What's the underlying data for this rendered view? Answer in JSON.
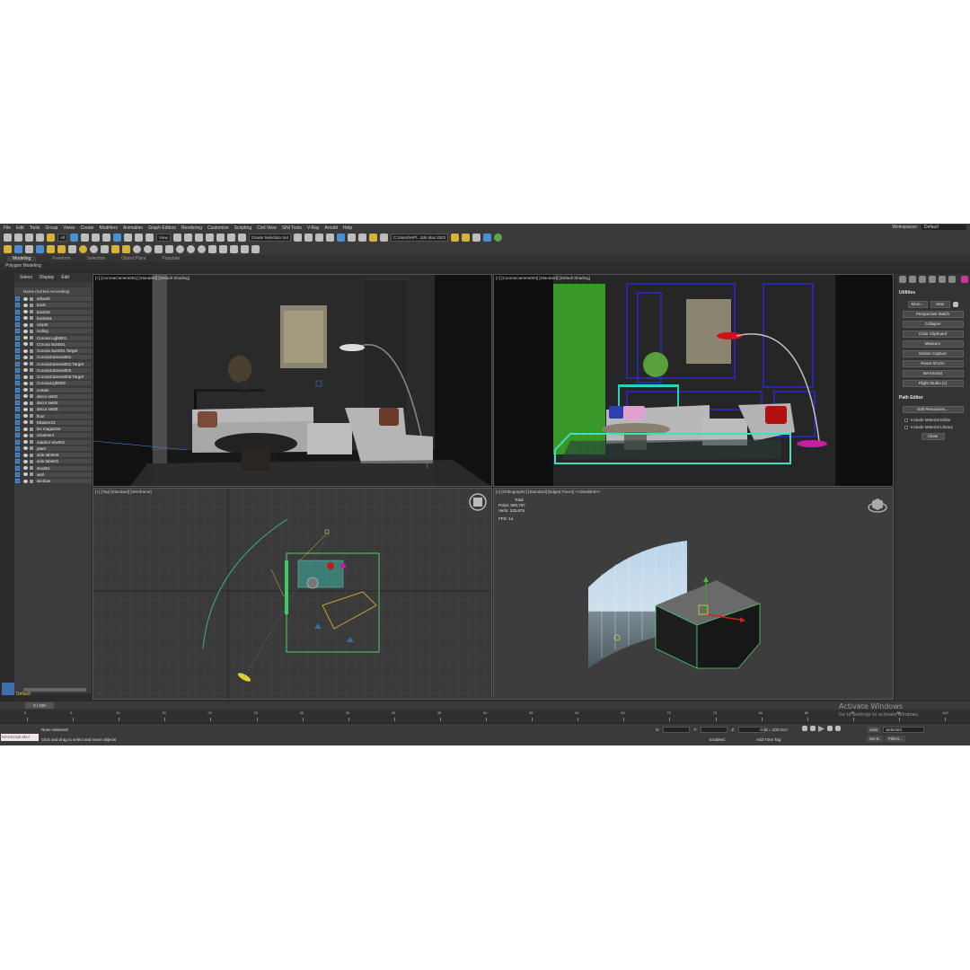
{
  "menubar": {
    "items": [
      "File",
      "Edit",
      "Tools",
      "Group",
      "Views",
      "Create",
      "Modifiers",
      "Animation",
      "Graph Editors",
      "Rendering",
      "Customize",
      "Scripting",
      "Civil View",
      "SiNi Tools",
      "V-Ray",
      "Arnold",
      "Help"
    ],
    "workspace_label": "Workspaces:",
    "workspace_value": "Default"
  },
  "toolbar": {
    "filter_value": "All",
    "view_value": "View",
    "selection_set": "Create Selection Set",
    "project_path": "C:\\Users\\HP\\...3ds Max 2023"
  },
  "ribbon": {
    "tabs": [
      "Modeling",
      "Freeform",
      "Selection",
      "Object Paint",
      "Populate"
    ],
    "active": "Modeling",
    "sub_label": "Polygon Modeling"
  },
  "scene_explorer": {
    "tabs": [
      "Select",
      "Display",
      "Edit"
    ],
    "header": "Name (Sorted Ascending)",
    "items": [
      "artwork",
      "book",
      "book15",
      "books01",
      "carpet",
      "ceiling",
      "Corona Light001",
      "Corona Sun001",
      "Corona Sun001.Target",
      "CoronaCamera001",
      "CoronaCamera001.Target",
      "CoronaCamera003",
      "CoronaCamera003.Target",
      "CoronaLight002",
      "curtain",
      "decor set01",
      "decor set02",
      "decor set05",
      "floor",
      "Kbaster23",
      "lec magazin4",
      "ornament",
      "outdoor env001",
      "plant",
      "side table00",
      "side table01",
      "stool01",
      "wall",
      "window"
    ],
    "layer": "Default"
  },
  "viewports": {
    "top_left": "[+] [CoronaCamera001] [Standard] [Default Shading]",
    "top_right": "[+] [CoronaCamera003] [Standard] [Default Shading]",
    "bottom_left": "[+] [Top] [Standard] [Wireframe]",
    "bottom_right": "[+] [Orthographic] [Standard] [Edged Faces] <<Disabled>>"
  },
  "stats": {
    "total_label": "Total",
    "polys_label": "Polys:",
    "polys": "580,757",
    "verts_label": "Verts:",
    "verts": "333,875",
    "fps_label": "FPS:",
    "fps": "14"
  },
  "command_panel": {
    "utilities_title": "Utilities",
    "more": "More...",
    "sets": "Sets",
    "buttons": [
      "Perspective Match",
      "Collapse",
      "Color Clipboard",
      "Measure",
      "Motion Capture",
      "Reset XForm",
      "MAXScript",
      "Flight Studio (c)"
    ],
    "path_editor_title": "Path Editor",
    "edit_resources": "Edit Resources...",
    "include_material_editor": "Include Material Editor",
    "include_material_library": "Include Material Library",
    "close": "Close"
  },
  "timeline": {
    "frame": "0 / 100",
    "ticks": [
      "0",
      "5",
      "10",
      "15",
      "20",
      "25",
      "30",
      "35",
      "40",
      "45",
      "50",
      "55",
      "60",
      "65",
      "70",
      "75",
      "80",
      "85",
      "90",
      "95",
      "100"
    ]
  },
  "status": {
    "maxscript": "MAXScript Mini",
    "selection": "None Selected",
    "prompt": "Click and drag to select and move objects",
    "x_label": "X:",
    "y_label": "Y:",
    "z_label": "Z:",
    "grid": "Grid = 100.0cm",
    "enabled": "Enabled:",
    "add_time_tag": "Add Time Tag",
    "auto": "Auto",
    "set_k": "Set K.",
    "selected": "Selected",
    "filters": "Filters..."
  },
  "watermark": {
    "title": "Activate Windows",
    "subtitle": "Go to Settings to activate Windows."
  }
}
